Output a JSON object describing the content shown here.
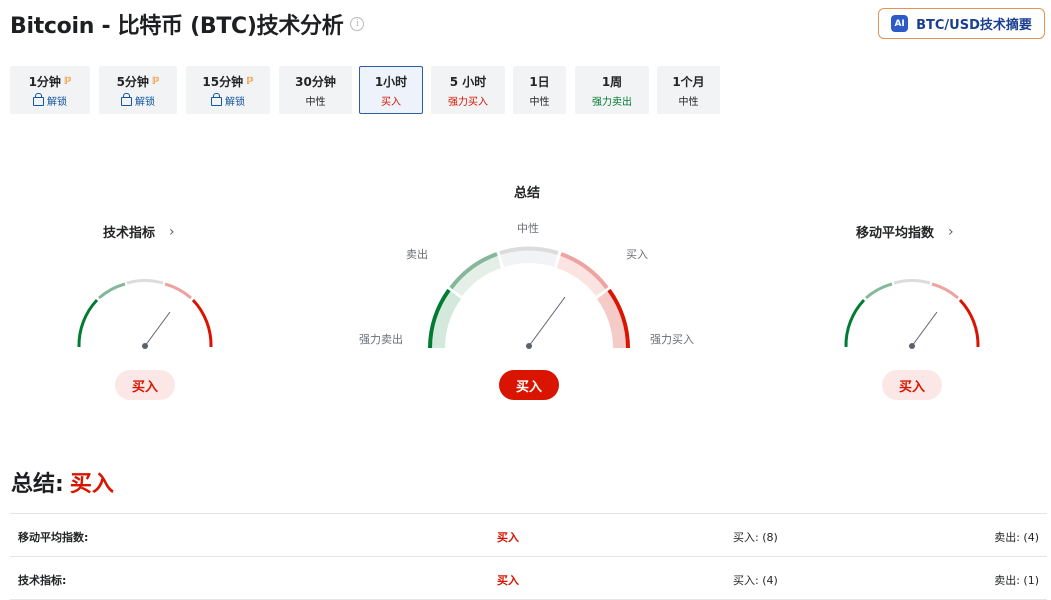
{
  "header": {
    "title": "Bitcoin - 比特币 (BTC)技术分析",
    "info_icon": "info-icon",
    "ai_badge": "AI",
    "ai_button_label": "BTC/USD技术摘要"
  },
  "timeframes": [
    {
      "label": "1分钟",
      "sub": "解锁",
      "locked": true
    },
    {
      "label": "5分钟",
      "sub": "解锁",
      "locked": true
    },
    {
      "label": "15分钟",
      "sub": "解锁",
      "locked": true
    },
    {
      "label": "30分钟",
      "sub": "中性",
      "locked": false
    },
    {
      "label": "1小时",
      "sub": "买入",
      "locked": false,
      "active": true
    },
    {
      "label": "5 小时",
      "sub": "强力买入",
      "locked": false
    },
    {
      "label": "1日",
      "sub": "中性",
      "locked": false
    },
    {
      "label": "1周",
      "sub": "强力卖出",
      "locked": false
    },
    {
      "label": "1个月",
      "sub": "中性",
      "locked": false
    }
  ],
  "pro_icon": "pro-icon",
  "gauges": {
    "technical": {
      "title": "技术指标",
      "verdict": "买入"
    },
    "summary": {
      "title": "总结",
      "verdict": "买入",
      "labels": {
        "neutral": "中性",
        "sell": "卖出",
        "buy": "买入",
        "strong_sell": "强力卖出",
        "strong_buy": "强力买入"
      }
    },
    "moving_averages": {
      "title": "移动平均指数",
      "verdict": "买入"
    }
  },
  "summary": {
    "label": "总结:",
    "verdict": "买入",
    "rows": [
      {
        "name": "移动平均指数:",
        "verdict": "买入",
        "buy": "买入: (8)",
        "sell": "卖出: (4)"
      },
      {
        "name": "技术指标:",
        "verdict": "买入",
        "buy": "买入: (4)",
        "sell": "卖出: (1)"
      }
    ]
  },
  "colors": {
    "buy_red": "#d91400",
    "sell_green": "#007c32",
    "accent_blue": "#1256a0",
    "ai_border": "#e59252"
  }
}
